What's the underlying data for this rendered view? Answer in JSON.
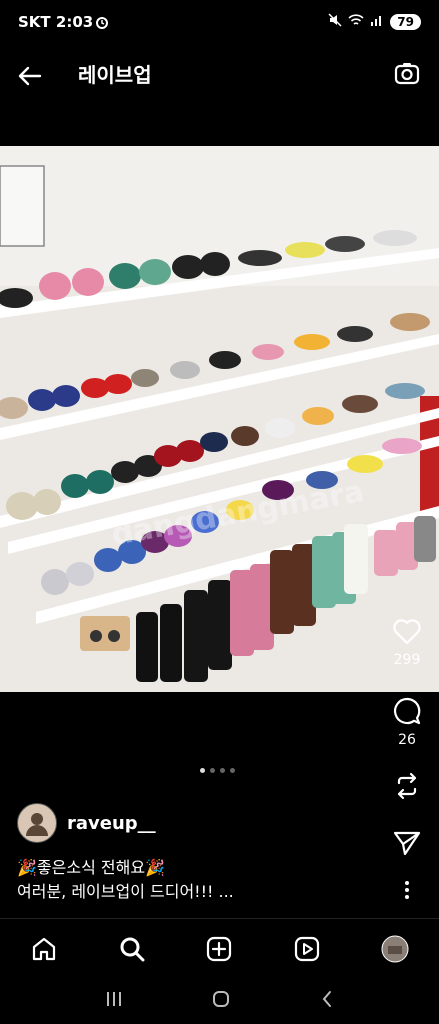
{
  "status": {
    "carrier_time": "SKT 2:03",
    "battery": "79"
  },
  "header": {
    "title": "레이브업"
  },
  "post": {
    "likes": "299",
    "comments": "26",
    "username": "raveup__",
    "caption_line1": "🎉좋은소식 전해요🎉",
    "caption_line2": "여러분, 레이브업이 드디어!!! ...",
    "watermark": "dangdangmara"
  },
  "colors": {
    "background": "#000000",
    "text": "#ffffff",
    "wall": "#e9e7e4"
  }
}
